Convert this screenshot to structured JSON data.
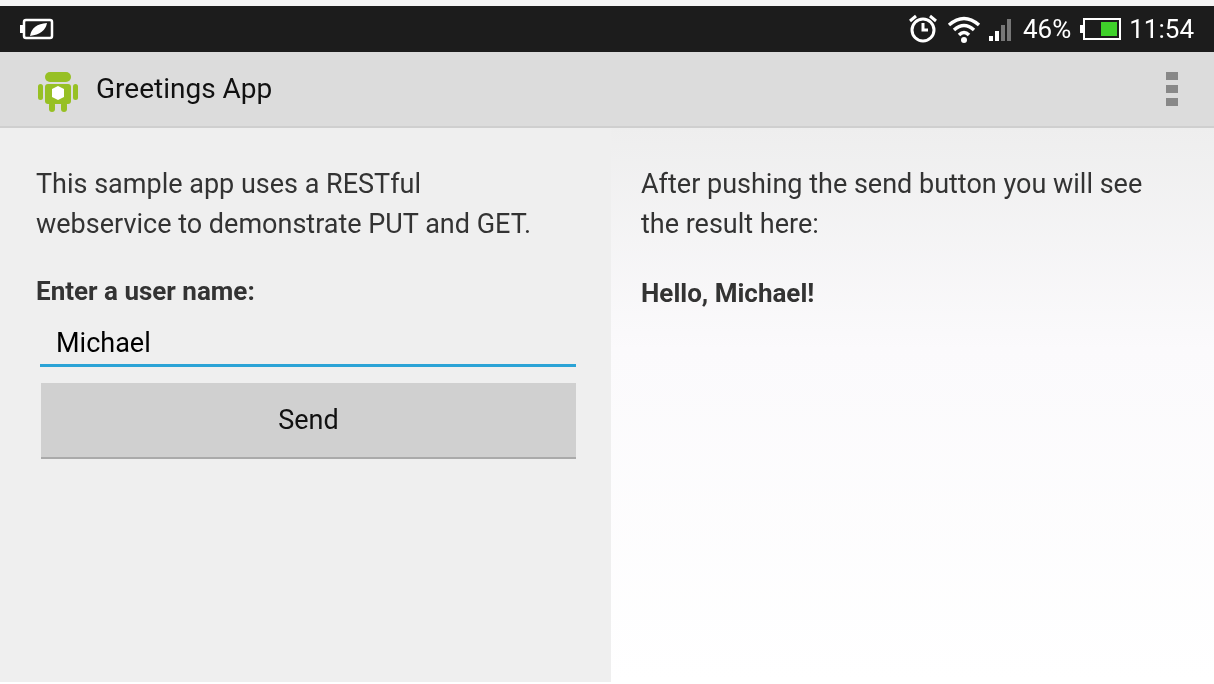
{
  "status_bar": {
    "battery_percent": "46%",
    "time": "11:54"
  },
  "action_bar": {
    "title": "Greetings App"
  },
  "left_panel": {
    "description": "This sample app uses a RESTful webservice to demonstrate PUT and GET.",
    "field_label": "Enter a user name:",
    "field": {
      "value": "Michael"
    },
    "button": "Send"
  },
  "right_panel": {
    "instructions": "After pushing the send button you will see the result here:",
    "result": "Hello, Michael!"
  }
}
